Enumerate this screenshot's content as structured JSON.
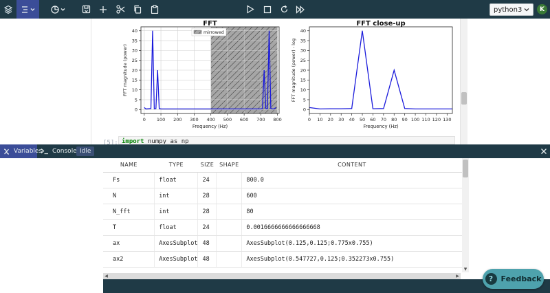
{
  "toolbar": {
    "kernel_name": "python3",
    "user_initial": "K"
  },
  "notebook": {
    "cell_prompt": "[5]:",
    "cell_code_keyword": "import",
    "cell_code_rest": " numpy as np"
  },
  "chart_data": [
    {
      "type": "line",
      "title": "FFT",
      "xlabel": "Frequency (Hz)",
      "ylabel": "FFT magnitude (power)",
      "xlim": [
        -20,
        810
      ],
      "ylim": [
        -2,
        42
      ],
      "xticks": [
        0,
        100,
        200,
        300,
        400,
        500,
        600,
        700,
        800
      ],
      "yticks": [
        0,
        5,
        10,
        15,
        20,
        25,
        30,
        35,
        40
      ],
      "grid": true,
      "legend": {
        "position": "top-center",
        "entries": [
          "mirrowed"
        ]
      },
      "shaded_region": {
        "x": [
          400,
          800
        ],
        "pattern": "hatched",
        "color": "#a0a0a0"
      },
      "series": [
        {
          "color": "#1a1adb",
          "x": [
            0,
            10,
            40,
            50,
            60,
            70,
            80,
            90,
            100,
            200,
            300,
            400,
            500,
            600,
            700,
            710,
            720,
            730,
            740,
            750,
            760,
            770,
            780,
            790
          ],
          "y": [
            1,
            0.3,
            0.5,
            40,
            0.4,
            0.5,
            20,
            0.5,
            0.3,
            0.3,
            0.3,
            0.3,
            0.3,
            0.3,
            0.3,
            0.5,
            20,
            0.5,
            0.4,
            40,
            0.5,
            0.3,
            0.3,
            1
          ]
        }
      ]
    },
    {
      "type": "line",
      "title": "FFT close-up",
      "xlabel": "Frequency (Hz)",
      "ylabel": "FFT magnitude (power) - log",
      "xlim": [
        0,
        135
      ],
      "ylim": [
        -2,
        42
      ],
      "xticks": [
        0,
        10,
        20,
        30,
        40,
        50,
        60,
        70,
        80,
        90,
        100,
        110,
        120,
        130
      ],
      "yticks": [
        0,
        5,
        10,
        15,
        20,
        25,
        30,
        35,
        40
      ],
      "grid": false,
      "series": [
        {
          "color": "#1a1adb",
          "x": [
            0,
            10,
            20,
            30,
            40,
            50,
            60,
            70,
            80,
            90,
            100,
            110,
            120,
            130,
            135
          ],
          "y": [
            1,
            0.3,
            0.4,
            0.4,
            0.5,
            40,
            0.4,
            0.5,
            20,
            0.5,
            0.3,
            0.3,
            0.3,
            0.3,
            0.3
          ]
        }
      ]
    }
  ],
  "panel": {
    "tabs": [
      {
        "label": "Variables",
        "active": true
      },
      {
        "label": "Console",
        "active": false
      }
    ],
    "status": "Idle"
  },
  "variables": {
    "columns": [
      "NAME",
      "TYPE",
      "SIZE",
      "SHAPE",
      "CONTENT"
    ],
    "rows": [
      {
        "name": "Fs",
        "type": "float",
        "size": "24",
        "shape": "",
        "content": "800.0"
      },
      {
        "name": "N",
        "type": "int",
        "size": "28",
        "shape": "",
        "content": "600"
      },
      {
        "name": "N_fft",
        "type": "int",
        "size": "28",
        "shape": "",
        "content": "80"
      },
      {
        "name": "T",
        "type": "float",
        "size": "24",
        "shape": "",
        "content": "0.0016666666666666668"
      },
      {
        "name": "ax",
        "type": "AxesSubplot",
        "size": "48",
        "shape": "",
        "content": "AxesSubplot(0.125,0.125;0.775x0.755)"
      },
      {
        "name": "ax2",
        "type": "AxesSubplot",
        "size": "48",
        "shape": "",
        "content": "AxesSubplot(0.547727,0.125;0.352273x0.755)"
      }
    ]
  },
  "feedback": {
    "label": "Feedback",
    "icon_glyph": "?"
  }
}
